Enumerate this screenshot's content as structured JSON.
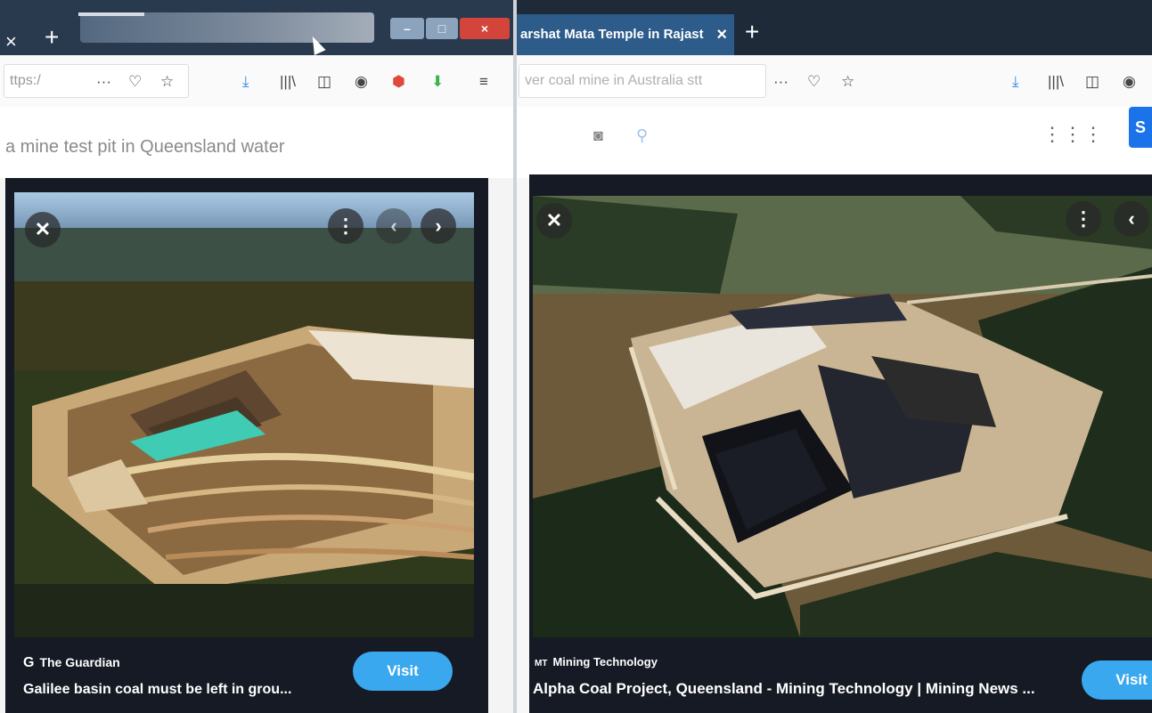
{
  "left_window": {
    "tab_close": "×",
    "new_tab": "+",
    "window_controls": {
      "minimize": "–",
      "maximize": "□",
      "close": "×"
    },
    "url": "ttps:/",
    "toolbar_icons": [
      "more-icon",
      "pocket-icon",
      "star-icon",
      "download-icon",
      "library-icon",
      "sidebar-icon",
      "account-icon",
      "ublock-icon",
      "download-alt-icon",
      "sync-icon"
    ],
    "search_query": "a mine test pit in Queensland water",
    "preview": {
      "source": "The Guardian",
      "source_logo": "G",
      "caption": "Galilee basin coal must be left in grou...",
      "visit_label": "Visit"
    }
  },
  "right_window": {
    "tab_title": "arshat Mata Temple in Rajast",
    "tab_close": "×",
    "new_tab": "+",
    "url": "ver coal mine in Australia stt",
    "toolbar_icons": [
      "more-icon",
      "pocket-icon",
      "star-icon",
      "download-icon",
      "library-icon",
      "sidebar-icon",
      "account-icon"
    ],
    "apps_icon": "⋮⋮⋮",
    "signin_label": "S",
    "preview": {
      "source": "Mining Technology",
      "source_logo": "MT",
      "caption": "Alpha Coal Project, Queensland - Mining Technology | Mining News ...",
      "visit_label": "Visit"
    }
  }
}
